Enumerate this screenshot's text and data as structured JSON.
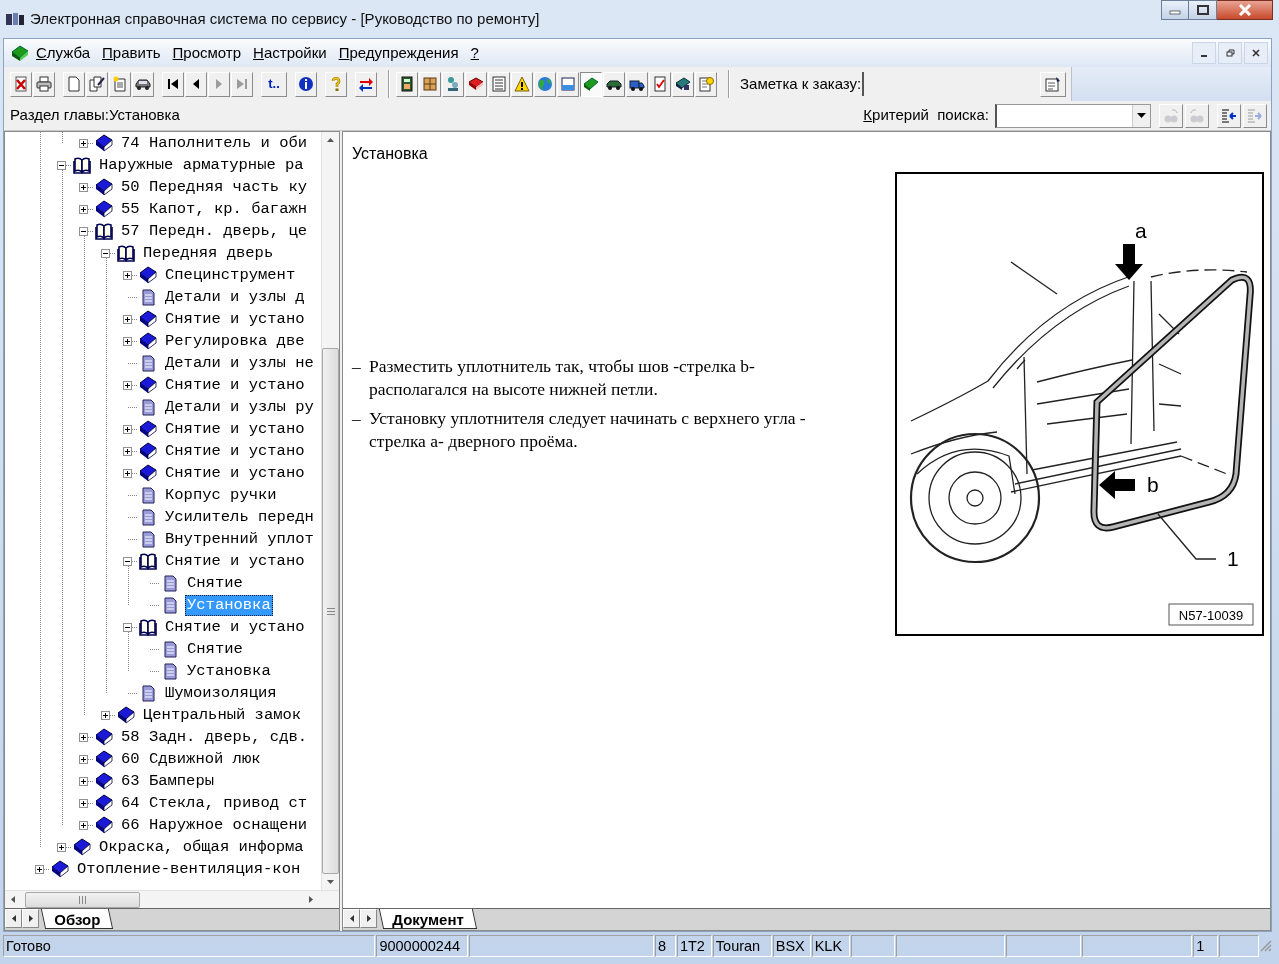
{
  "window": {
    "title": "Электронная справочная система по сервису - [Руководство по ремонту]"
  },
  "menu": [
    "Служба",
    "Править",
    "Просмотр",
    "Настройки",
    "Предупреждения",
    "?"
  ],
  "toolbar": {
    "buttons": [
      {
        "disabled": false,
        "pressed": false
      },
      {
        "disabled": false,
        "pressed": false
      },
      {
        "disabled": false,
        "pressed": false
      },
      {
        "disabled": false,
        "pressed": false
      },
      {
        "disabled": false,
        "pressed": false
      },
      {
        "disabled": false,
        "pressed": false
      },
      {
        "disabled": false,
        "pressed": false
      },
      {
        "disabled": false,
        "pressed": false
      },
      {
        "disabled": true,
        "pressed": false
      },
      {
        "disabled": true,
        "pressed": false
      },
      {
        "label": "t..",
        "disabled": false,
        "pressed": false
      },
      {
        "disabled": false,
        "pressed": false
      },
      {
        "disabled": false,
        "pressed": false
      },
      {
        "disabled": false,
        "pressed": false
      },
      {
        "disabled": false,
        "pressed": false
      },
      {
        "disabled": false,
        "pressed": false
      },
      {
        "disabled": false,
        "pressed": false
      },
      {
        "disabled": false,
        "pressed": false
      },
      {
        "disabled": false,
        "pressed": false
      },
      {
        "disabled": false,
        "pressed": false
      },
      {
        "disabled": false,
        "pressed": false
      },
      {
        "disabled": false,
        "pressed": false
      },
      {
        "disabled": false,
        "pressed": true
      },
      {
        "disabled": false,
        "pressed": false
      },
      {
        "disabled": false,
        "pressed": false
      },
      {
        "disabled": false,
        "pressed": false
      },
      {
        "disabled": false,
        "pressed": false
      },
      {
        "disabled": false,
        "pressed": false
      }
    ],
    "note_label": "Заметка к заказу:"
  },
  "chapter": {
    "text": "Раздел главы:Установка"
  },
  "search": {
    "label": "Критерий  поиска:",
    "buttons": [
      {
        "disabled": true
      },
      {
        "disabled": true
      },
      {
        "disabled": false
      },
      {
        "disabled": true
      }
    ]
  },
  "tree": {
    "nodes": [
      {
        "children": [
          {
            "children": [
              {
                "kind": "book",
                "label": "74 Наполнитель и оби",
                "expanded": false,
                "selected": false
              }
            ]
          },
          {
            "kind": "book",
            "label": "Наружные арматурные ра",
            "expanded": true,
            "selected": false,
            "children": [
              {
                "kind": "book",
                "label": "50 Передняя часть ку",
                "expanded": false,
                "selected": false
              },
              {
                "kind": "book",
                "label": "55 Капот, кр. багажн",
                "expanded": false,
                "selected": false
              },
              {
                "kind": "book",
                "label": "57 Передн. дверь, це",
                "expanded": true,
                "selected": false,
                "children": [
                  {
                    "kind": "book",
                    "label": "Передняя дверь",
                    "expanded": true,
                    "selected": false,
                    "children": [
                      {
                        "kind": "book",
                        "label": "Специнструмент",
                        "expanded": false,
                        "selected": false
                      },
                      {
                        "kind": "page",
                        "label": "Детали и узлы д",
                        "selected": false
                      },
                      {
                        "kind": "book",
                        "label": "Снятие и устано",
                        "expanded": false,
                        "selected": false
                      },
                      {
                        "kind": "book",
                        "label": "Регулировка две",
                        "expanded": false,
                        "selected": false
                      },
                      {
                        "kind": "page",
                        "label": "Детали и узлы не",
                        "selected": false
                      },
                      {
                        "kind": "book",
                        "label": "Снятие и устано",
                        "expanded": false,
                        "selected": false
                      },
                      {
                        "kind": "page",
                        "label": "Детали и узлы ру",
                        "selected": false
                      },
                      {
                        "kind": "book",
                        "label": "Снятие и устано",
                        "expanded": false,
                        "selected": false
                      },
                      {
                        "kind": "book",
                        "label": "Снятие и устано",
                        "expanded": false,
                        "selected": false
                      },
                      {
                        "kind": "book",
                        "label": "Снятие и устано",
                        "expanded": false,
                        "selected": false
                      },
                      {
                        "kind": "page",
                        "label": "Корпус ручки",
                        "selected": false
                      },
                      {
                        "kind": "page",
                        "label": "Усилитель передн",
                        "selected": false
                      },
                      {
                        "kind": "page",
                        "label": "Внутренний уплот",
                        "selected": false
                      },
                      {
                        "kind": "book",
                        "label": "Снятие и устано",
                        "expanded": true,
                        "selected": false,
                        "children": [
                          {
                            "kind": "page",
                            "label": "Снятие",
                            "selected": false
                          },
                          {
                            "kind": "page",
                            "label": "Установка",
                            "selected": true
                          }
                        ]
                      },
                      {
                        "kind": "book",
                        "label": "Снятие и устано",
                        "expanded": true,
                        "selected": false,
                        "children": [
                          {
                            "kind": "page",
                            "label": "Снятие",
                            "selected": false
                          },
                          {
                            "kind": "page",
                            "label": "Установка",
                            "selected": false
                          }
                        ]
                      },
                      {
                        "kind": "page",
                        "label": "Шумоизоляция",
                        "selected": false
                      }
                    ]
                  },
                  {
                    "kind": "book",
                    "label": "Центральный замок",
                    "expanded": false,
                    "selected": false
                  }
                ]
              },
              {
                "kind": "book",
                "label": "58 Задн. дверь, сдв.",
                "expanded": false,
                "selected": false
              },
              {
                "kind": "book",
                "label": "60 Сдвижной люк",
                "expanded": false,
                "selected": false
              },
              {
                "kind": "book",
                "label": "63 Бамперы",
                "expanded": false,
                "selected": false
              },
              {
                "kind": "book",
                "label": "64 Стекла, привод ст",
                "expanded": false,
                "selected": false
              },
              {
                "kind": "book",
                "label": "66 Наружное оснащени",
                "expanded": false,
                "selected": false
              }
            ]
          },
          {
            "kind": "book",
            "label": "Окраска, общая информа",
            "expanded": false,
            "selected": false
          }
        ]
      },
      {
        "kind": "book",
        "label": "Отопление-вентиляция-кон",
        "expanded": false,
        "selected": false
      }
    ]
  },
  "left_tabs": [
    {
      "label": "Обзор",
      "selected": true
    }
  ],
  "document": {
    "title": "Установка",
    "bullets": [
      {
        "marker": "–",
        "lines": [
          "Разместить уплотнитель так, чтобы шов -стрелка b-",
          "располагался на высоте нижней петли."
        ]
      },
      {
        "marker": "–",
        "lines": [
          "Установку уплотнителя следует начинать с верхнего угла -",
          "стрелка a- дверного проёма."
        ]
      }
    ],
    "figure": {
      "callouts": [
        "a",
        "b",
        "1"
      ],
      "code": "N57-10039"
    }
  },
  "right_tabs": [
    {
      "label": "Документ",
      "selected": true
    }
  ],
  "status_bar": {
    "message": "Готово",
    "fields": [
      "9000000244",
      "8",
      "1T2",
      "Touran",
      "BSX",
      "KLK",
      "1"
    ]
  }
}
